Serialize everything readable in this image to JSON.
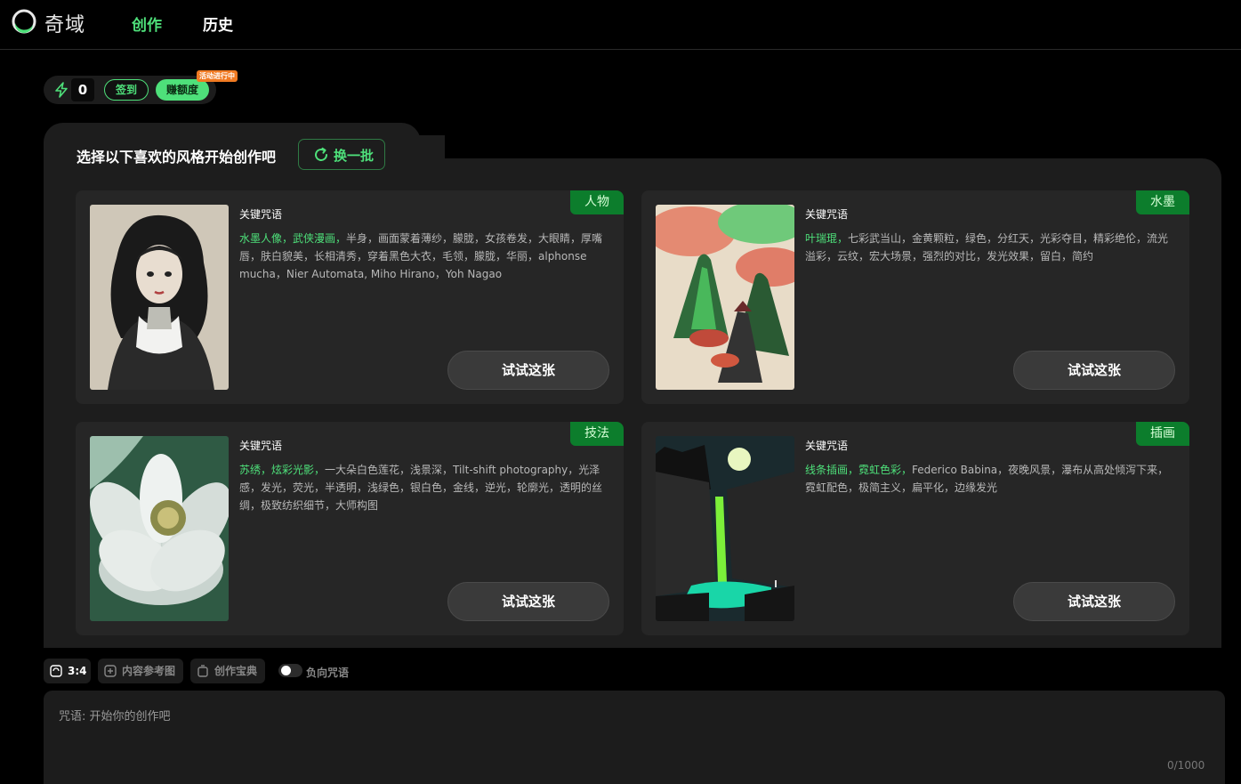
{
  "header": {
    "logo_text": "奇域",
    "nav": [
      {
        "label": "创作",
        "active": true
      },
      {
        "label": "历史",
        "active": false
      }
    ]
  },
  "credits": {
    "count": "0",
    "signin_label": "签到",
    "earn_label": "赚额度",
    "event_badge": "活动进行中"
  },
  "gallery": {
    "title": "选择以下喜欢的风格开始创作吧",
    "refresh_label": "换一批",
    "cards": [
      {
        "tag": "人物",
        "label": "关键咒语",
        "highlight": "水墨人像，武侠漫画，",
        "prompt": "半身，画面蒙着薄纱，朦胧，女孩卷发，大眼睛，厚嘴唇，肤白貌美，长相清秀，穿着黑色大衣，毛领，朦胧，华丽，alphonse mucha，Nier Automata, Miho Hirano，Yoh Nagao",
        "button": "试试这张"
      },
      {
        "tag": "水墨",
        "label": "关键咒语",
        "highlight": "叶瑞琨，",
        "prompt": "七彩武当山，金黄颗粒，绿色，分红天，光彩夺目，精彩绝伦，流光溢彩，云纹，宏大场景，强烈的对比，发光效果，留白，简约",
        "button": "试试这张"
      },
      {
        "tag": "技法",
        "label": "关键咒语",
        "highlight": "苏绣，炫彩光影，",
        "prompt": "一大朵白色莲花，浅景深，Tilt-shift photography，光泽感，发光，荧光，半透明，浅绿色，银白色，金线，逆光，轮廓光，透明的丝绸，极致纺织细节，大师构图",
        "button": "试试这张"
      },
      {
        "tag": "插画",
        "label": "关键咒语",
        "highlight": "线条插画，霓虹色彩，",
        "prompt": "Federico Babina，夜晚风景，瀑布从高处倾泻下来，霓虹配色，极简主义，扁平化，边缘发光",
        "button": "试试这张"
      }
    ]
  },
  "toolbar": {
    "ratio_label": "3:4",
    "reference_label": "内容参考图",
    "dictionary_label": "创作宝典",
    "negative_label": "负向咒语",
    "negative_enabled": false
  },
  "prompt": {
    "placeholder": "咒语: 开始你的创作吧",
    "counter": "0/1000"
  },
  "colors": {
    "accent": "#4ee07a",
    "tag_bg": "#0c7d2c",
    "badge": "#f07a22"
  }
}
